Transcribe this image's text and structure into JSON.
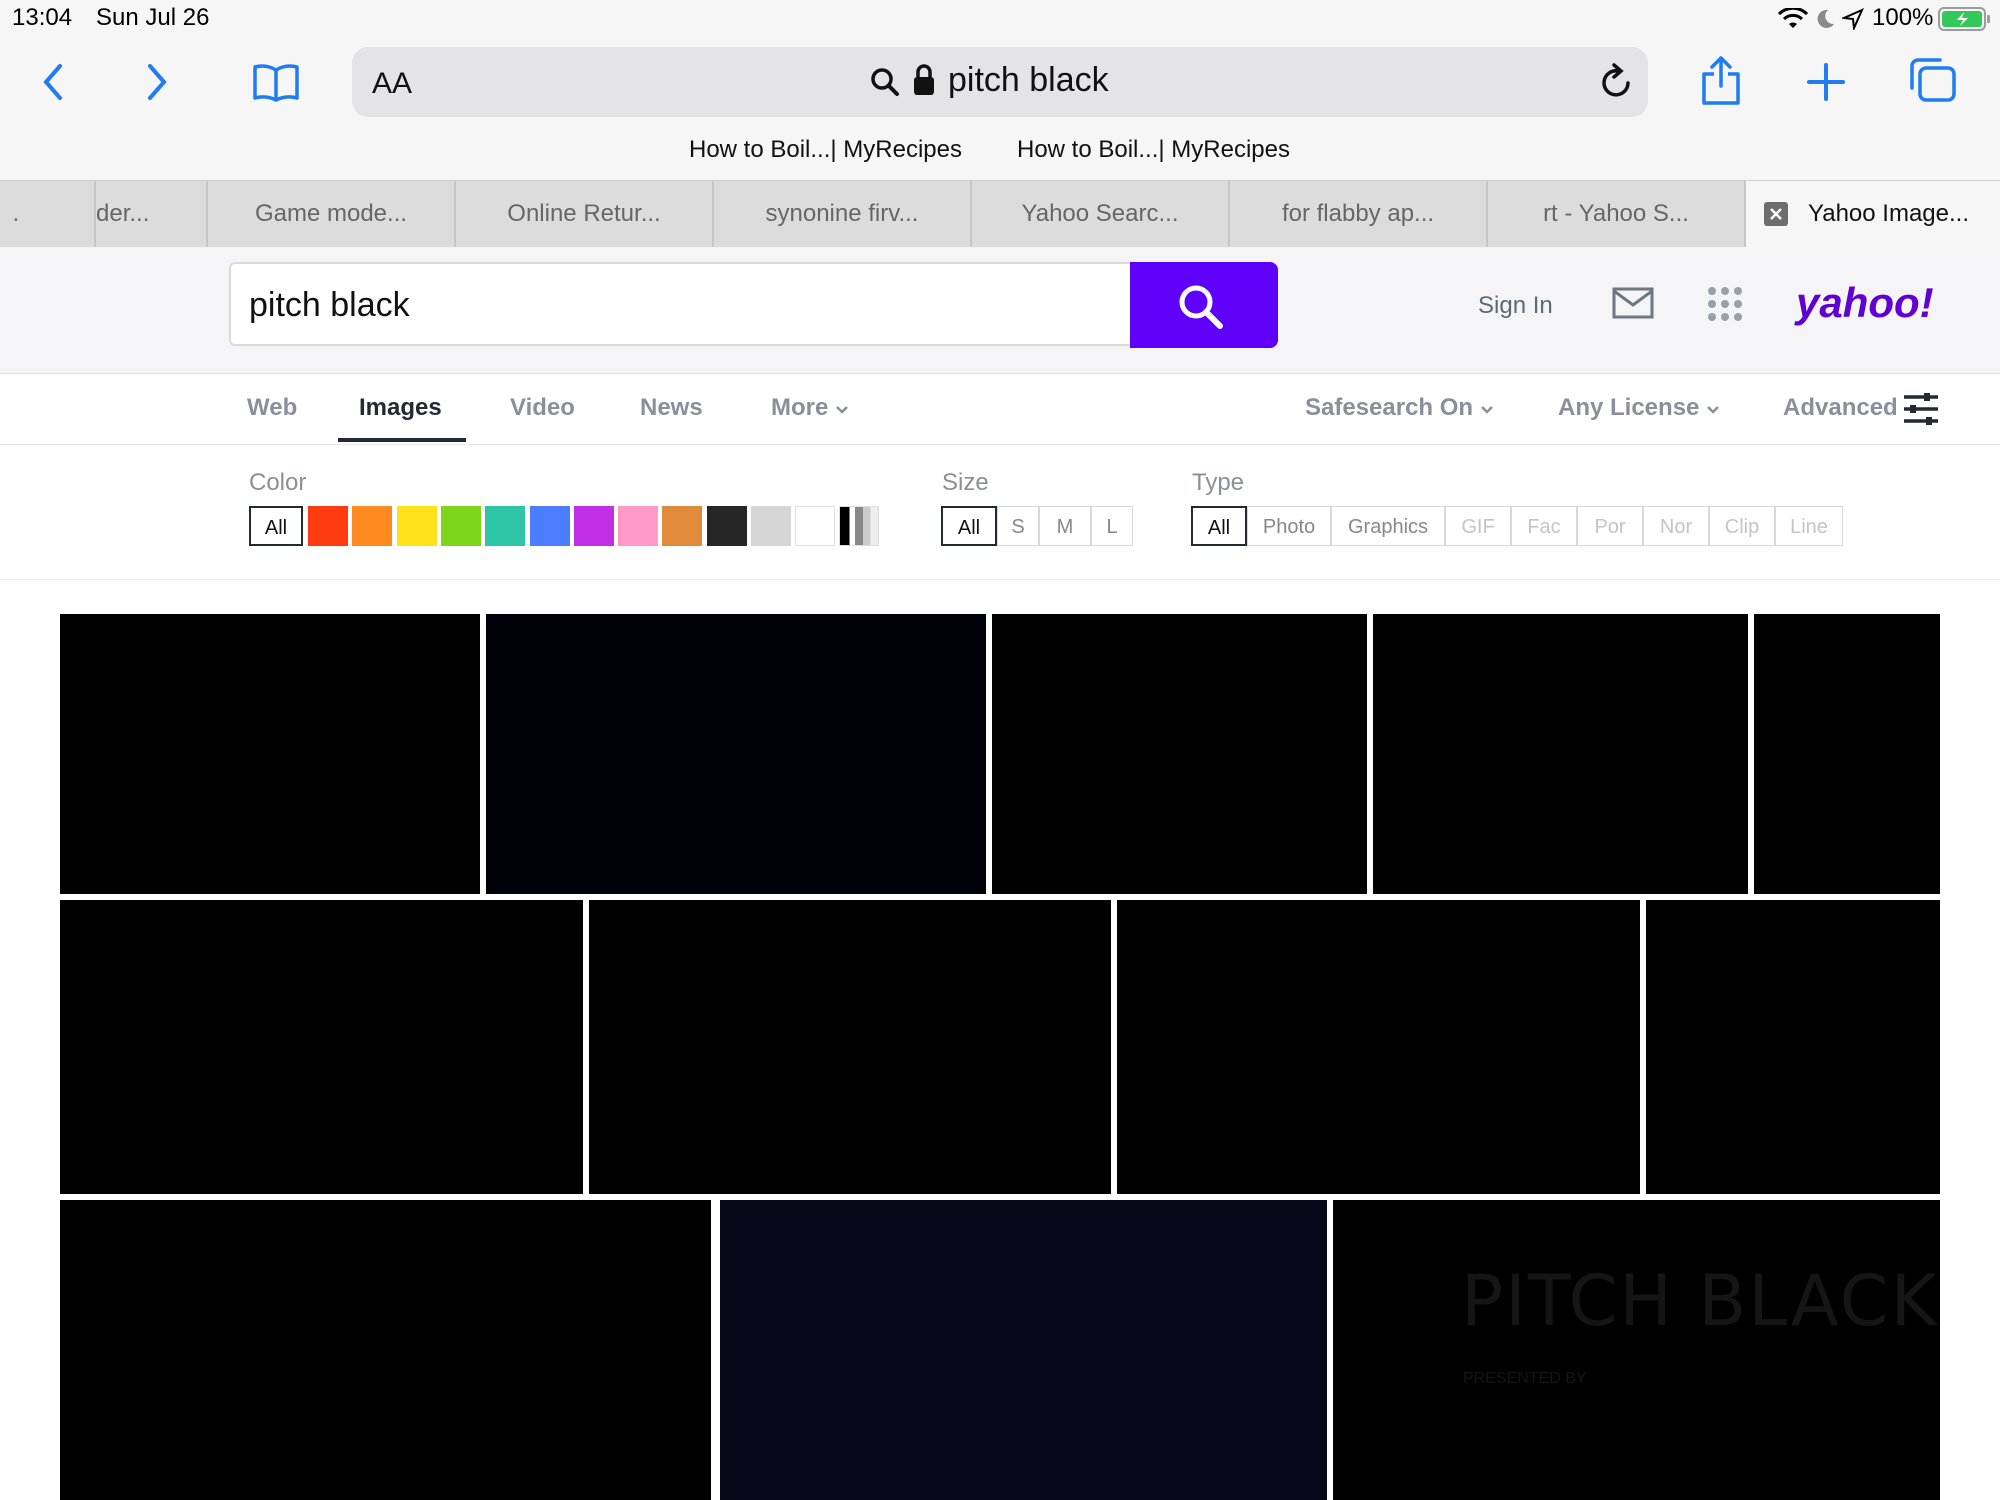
{
  "status_bar": {
    "time": "13:04",
    "date": "Sun Jul 26",
    "battery": "100%"
  },
  "browser": {
    "text_size_label": "AA",
    "url_text": "pitch black",
    "bookmarks": [
      "How to Boil...| MyRecipes",
      "How to Boil...| MyRecipes"
    ],
    "tabs": [
      {
        "label": "."
      },
      {
        "label": "der..."
      },
      {
        "label": "Game mode..."
      },
      {
        "label": "Online Retur..."
      },
      {
        "label": "synonine firv..."
      },
      {
        "label": "Yahoo Searc..."
      },
      {
        "label": "for flabby ap..."
      },
      {
        "label": "rt - Yahoo S..."
      },
      {
        "label": "Yahoo Image..."
      }
    ],
    "active_tab": "Yahoo Image...",
    "accent_color": "#1f7cf2"
  },
  "yahoo": {
    "search_value": "pitch black",
    "sign_in": "Sign In",
    "logo": "yahoo!",
    "brand_color": "#5f01f9",
    "nav": {
      "web": "Web",
      "images": "Images",
      "video": "Video",
      "news": "News",
      "more": "More",
      "safesearch": "Safesearch On",
      "license": "Any License",
      "advanced": "Advanced",
      "active": "Images"
    },
    "filters": {
      "color_label": "Color",
      "color_all": "All",
      "colors": [
        "#ff3b12",
        "#ff8a1f",
        "#ffe21a",
        "#7ed61a",
        "#2ec6a6",
        "#4c7cff",
        "#c02ee6",
        "#ff9ac6",
        "#e08a3c",
        "#262626",
        "#d6d6d6",
        "#ffffff"
      ],
      "size_label": "Size",
      "sizes": [
        "All",
        "S",
        "M",
        "L"
      ],
      "type_label": "Type",
      "types": [
        "All",
        "Photo",
        "Graphics",
        "GIF",
        "Fac",
        "Por",
        "Nor",
        "Clip",
        "Line"
      ]
    },
    "results_overlay_text": {
      "title": "PITCH BLACK",
      "subtitle": "PRESENTED BY"
    }
  }
}
